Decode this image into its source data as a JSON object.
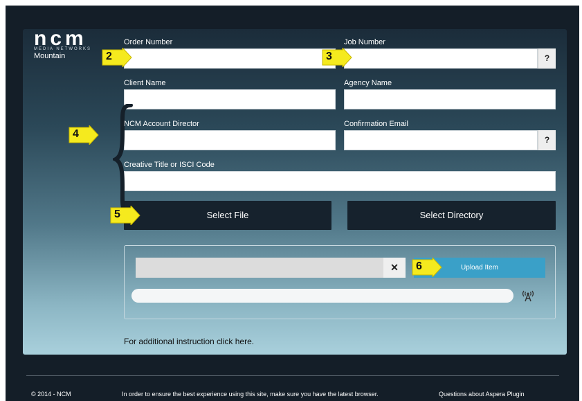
{
  "logo": {
    "mark": "ncm",
    "subtitle": "MEDIA NETWORKS",
    "location": "Mountain"
  },
  "fields": {
    "order_number": {
      "label": "Order Number",
      "value": ""
    },
    "job_number": {
      "label": "Job Number",
      "value": "",
      "help": "?"
    },
    "client_name": {
      "label": "Client Name",
      "value": ""
    },
    "agency_name": {
      "label": "Agency Name",
      "value": ""
    },
    "account_director": {
      "label": "NCM Account Director",
      "value": ""
    },
    "confirmation_email": {
      "label": "Confirmation Email",
      "value": "",
      "help": "?"
    },
    "creative_title": {
      "label": "Creative Title or ISCI Code",
      "value": ""
    }
  },
  "buttons": {
    "select_file": "Select File",
    "select_directory": "Select Directory",
    "upload_item": "Upload Item",
    "clear": "✕"
  },
  "upload": {
    "file_value": "",
    "progress_percent": 0
  },
  "instruction": "For additional instruction click here.",
  "markers": [
    "2",
    "3",
    "4",
    "5",
    "6"
  ],
  "footer": {
    "copyright": "© 2014 - NCM",
    "browser_notice": "In order to ensure the best experience using this site, make sure you have the latest browser.",
    "aspera": "Questions about Aspera Plugin"
  },
  "colors": {
    "accent": "#3aa0c8",
    "button_dark": "#16222d",
    "marker_yellow": "#f5ea1e"
  },
  "icons": {
    "signal": "broadcast-tower-icon"
  }
}
